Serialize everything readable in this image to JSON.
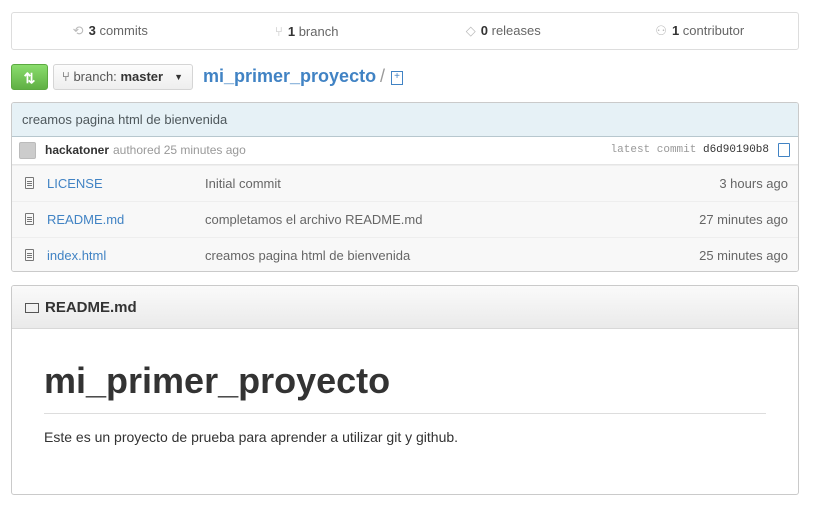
{
  "summary": {
    "commits": {
      "num": "3",
      "label": "commits",
      "icon": "history-icon"
    },
    "branches": {
      "num": "1",
      "label": "branch",
      "icon": "branch-icon"
    },
    "releases": {
      "num": "0",
      "label": "releases",
      "icon": "tag-icon"
    },
    "contributors": {
      "num": "1",
      "label": "contributor",
      "icon": "organization-icon"
    }
  },
  "toolbar": {
    "compare_icon": "compare-icon",
    "branch_label": "branch:",
    "branch_value": "master",
    "repo_name": "mi_primer_proyecto",
    "separator": "/",
    "new_file_glyph": "+"
  },
  "commit": {
    "title": "creamos pagina html de bienvenida",
    "author": "hackatoner",
    "authored": "authored 25 minutes ago",
    "latest_label": "latest commit",
    "sha": "d6d90190b8"
  },
  "files": [
    {
      "name": "LICENSE",
      "message": "Initial commit",
      "age": "3 hours ago"
    },
    {
      "name": "README.md",
      "message": "completamos el archivo README.md",
      "age": "27 minutes ago"
    },
    {
      "name": "index.html",
      "message": "creamos pagina html de bienvenida",
      "age": "25 minutes ago"
    }
  ],
  "readme": {
    "header": "README.md",
    "h1": "mi_primer_proyecto",
    "paragraph": "Este es un proyecto de prueba para aprender a utilizar git y github."
  },
  "colors": {
    "link": "#4183c4",
    "compare_green": "#60b044",
    "commit_bar": "#e6f1f6"
  }
}
